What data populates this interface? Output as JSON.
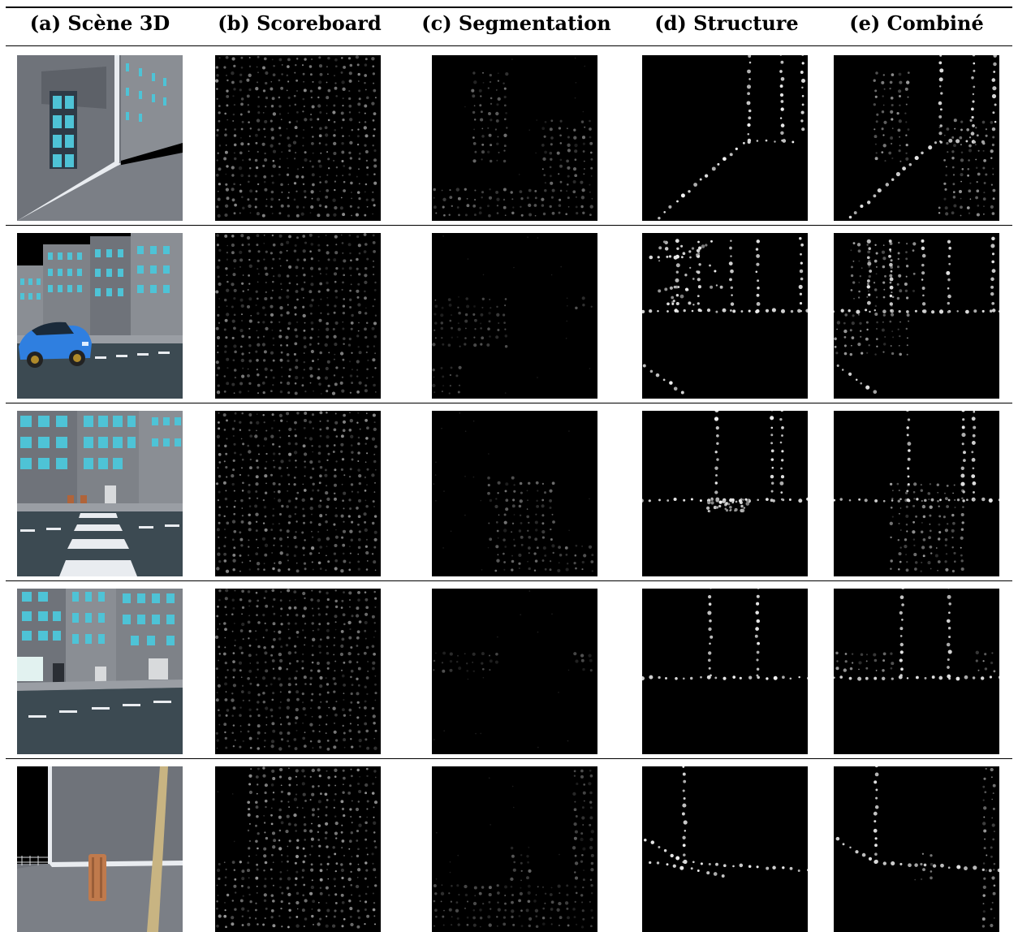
{
  "figure": {
    "columns": [
      {
        "id": "a",
        "label": "(a) Scène 3D"
      },
      {
        "id": "b",
        "label": "(b) Scoreboard"
      },
      {
        "id": "c",
        "label": "(c) Segmentation"
      },
      {
        "id": "d",
        "label": "(d) Structure"
      },
      {
        "id": "e",
        "label": "(e) Combiné"
      }
    ],
    "rows": [
      {
        "scene": "street corner with tall building and sidewalk"
      },
      {
        "scene": "city street with blue car"
      },
      {
        "scene": "crosswalk in front of buildings"
      },
      {
        "scene": "road at building corner with doors"
      },
      {
        "scene": "sidewalk wall with tree and trash bin"
      }
    ]
  },
  "colors": {
    "background": "#000000",
    "phosphene": "#ffffff",
    "building": "#6f737a",
    "window": "#4ec3d6",
    "sky": "#000000",
    "road": "#3c4a52"
  }
}
